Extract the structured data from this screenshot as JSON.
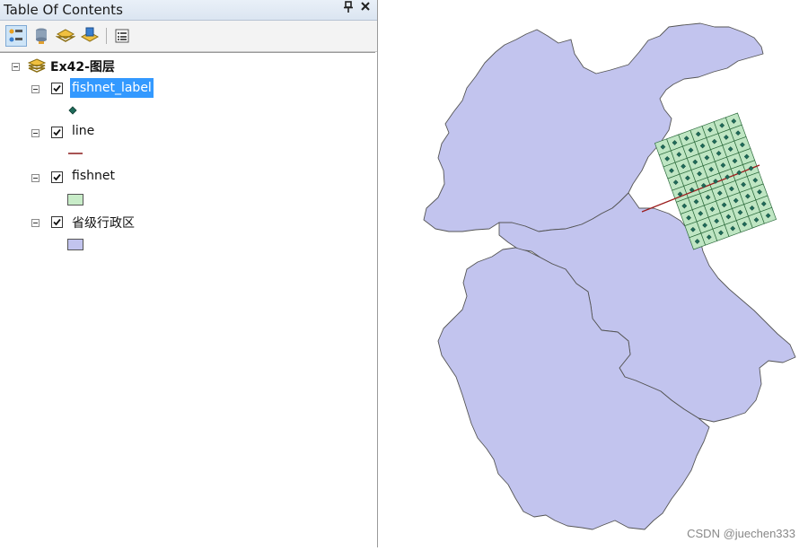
{
  "toc": {
    "title": "Table Of Contents",
    "pin_glyph": "↕",
    "close_glyph": "✕",
    "toolbar": [
      {
        "name": "list-by-drawing-order-button",
        "active": true
      },
      {
        "name": "list-by-source-button",
        "active": false
      },
      {
        "name": "list-by-visibility-button",
        "active": false
      },
      {
        "name": "list-by-selection-button",
        "active": false
      },
      {
        "name": "options-button",
        "active": false
      }
    ],
    "data_frame": {
      "label": "Ex42-图层"
    },
    "layers": [
      {
        "label": "fishnet_label",
        "checked": true,
        "symbol": "point",
        "symbol_color": "#1f6b5a",
        "selected": true
      },
      {
        "label": "line",
        "checked": true,
        "symbol": "line",
        "symbol_color": "#8b1a1a",
        "selected": false
      },
      {
        "label": "fishnet",
        "checked": true,
        "symbol": "fill",
        "symbol_color": "#c8ecc8",
        "selected": false
      },
      {
        "label": "省级行政区",
        "checked": true,
        "symbol": "fill",
        "symbol_color": "#c2c4ee",
        "selected": false
      }
    ]
  },
  "map": {
    "province_fill": "#c2c4ee",
    "province_stroke": "#555555",
    "fishnet_fill": "#bfe6c3",
    "fishnet_stroke": "#2c6b3c",
    "point_color": "#1f6b5a",
    "line_color": "#9b1c1c"
  },
  "watermark": "CSDN @juechen333"
}
